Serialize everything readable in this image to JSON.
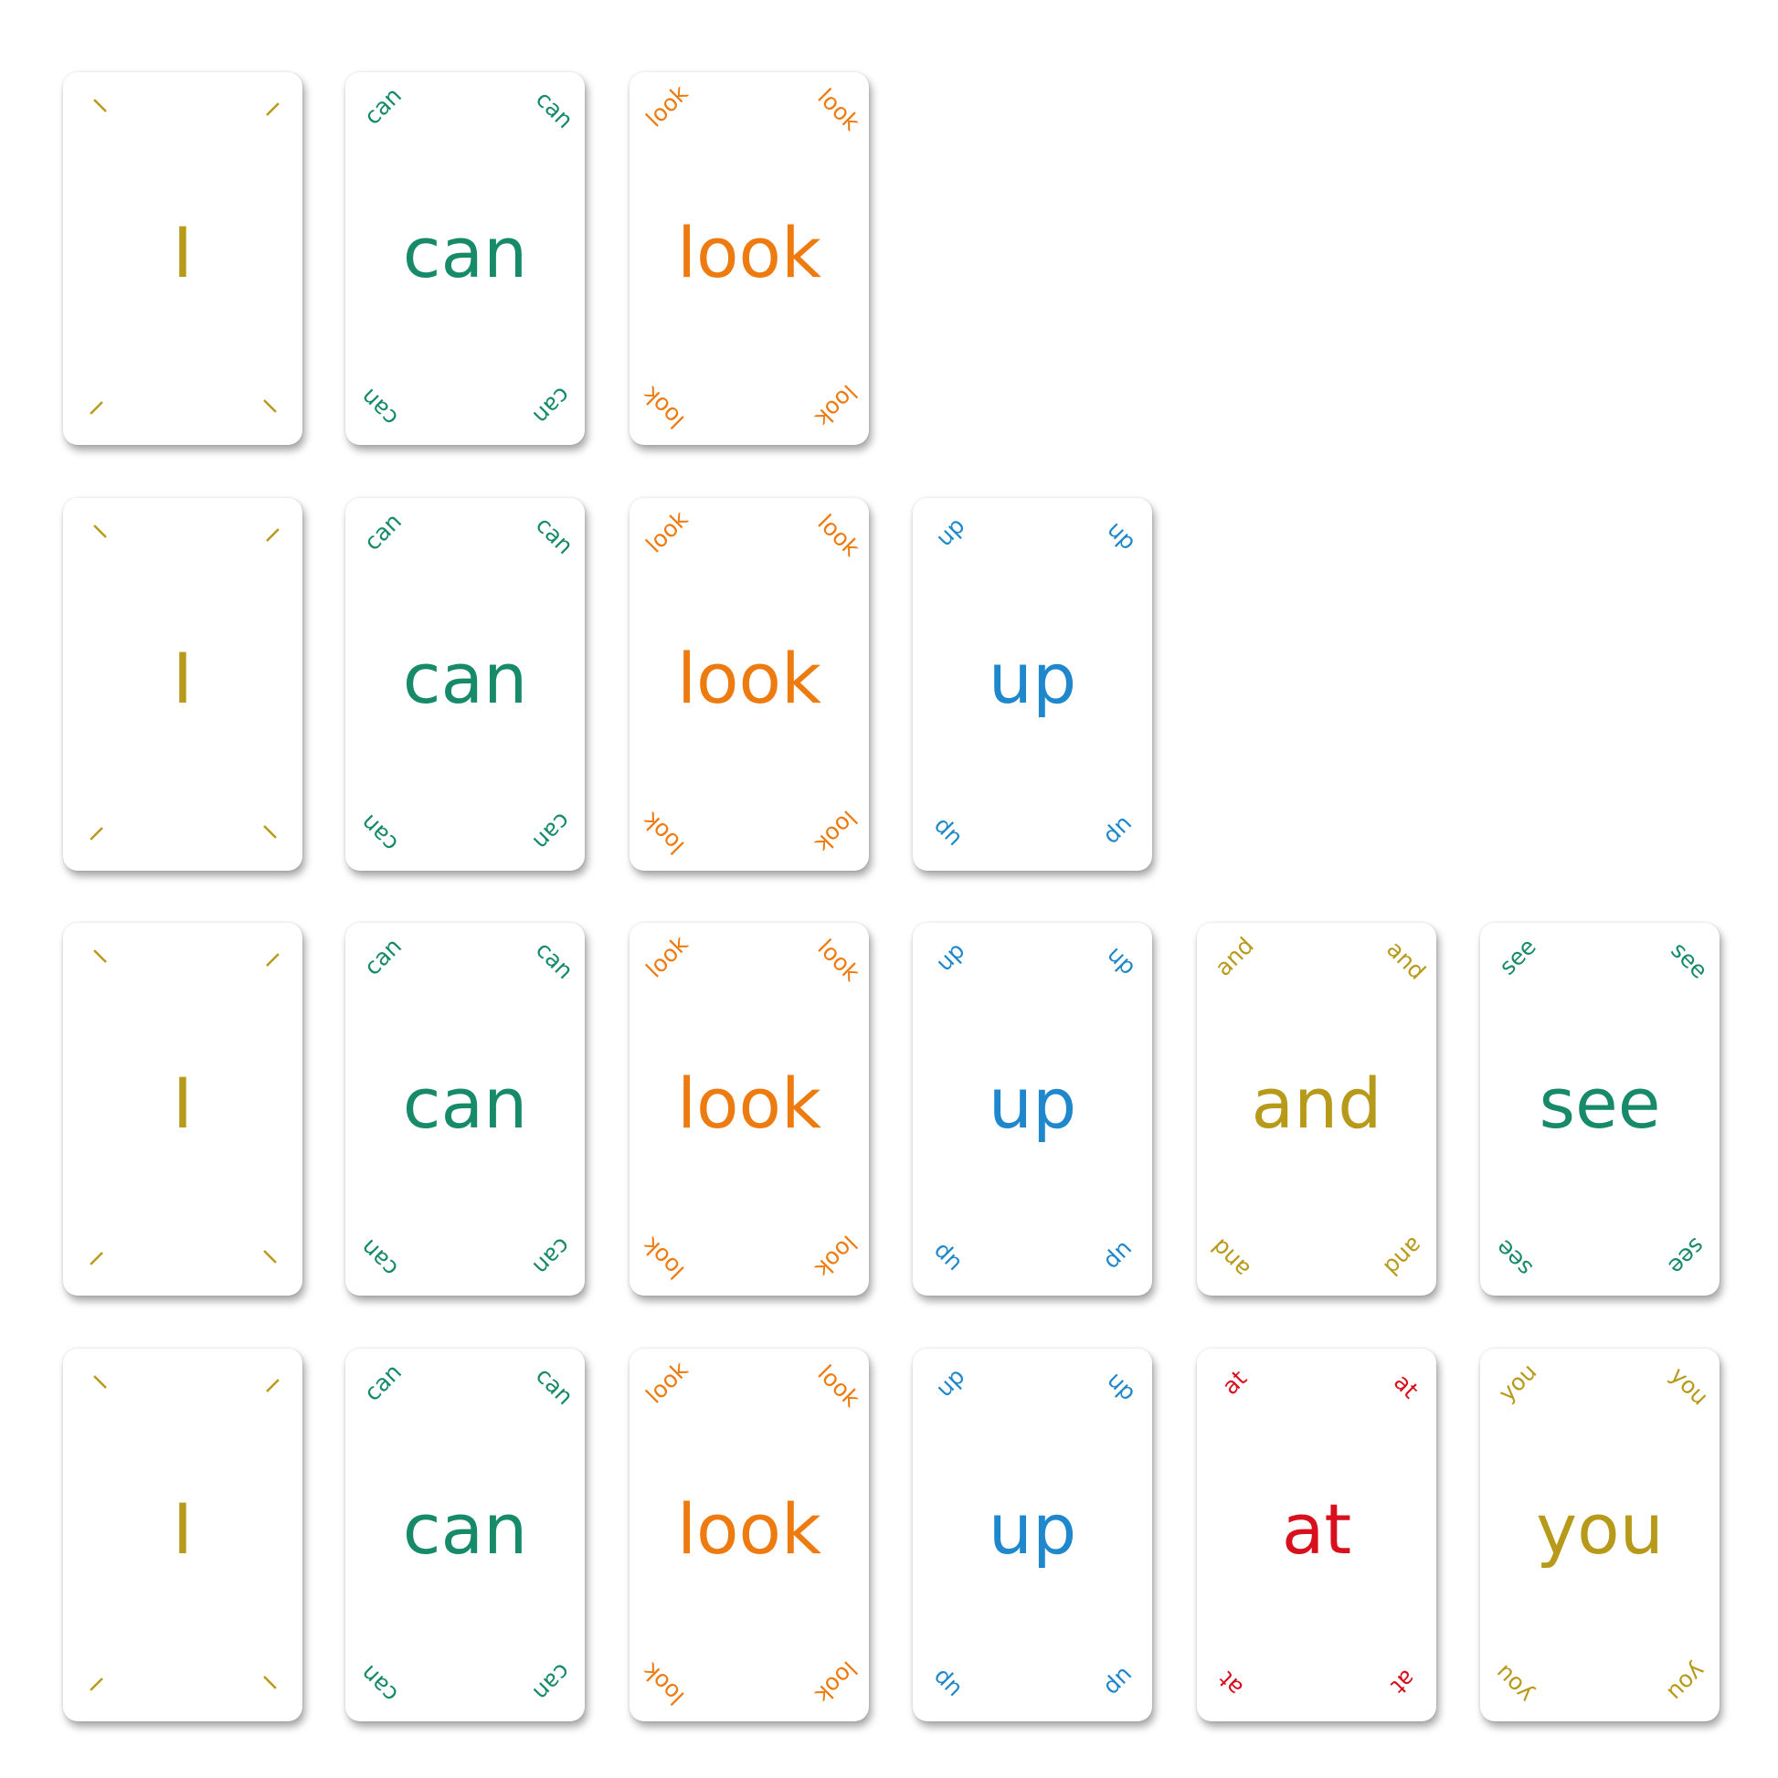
{
  "colors": {
    "I": "#b89a1a",
    "can": "#178a6a",
    "look": "#ee7b0f",
    "up": "#1f88cc",
    "and": "#b89a1a",
    "see": "#178a6a",
    "at": "#d8101e",
    "you": "#b89a1a"
  },
  "rows": [
    [
      "I",
      "can",
      "look"
    ],
    [
      "I",
      "can",
      "look",
      "up"
    ],
    [
      "I",
      "can",
      "look",
      "up",
      "and",
      "see"
    ],
    [
      "I",
      "can",
      "look",
      "up",
      "at",
      "you"
    ]
  ]
}
